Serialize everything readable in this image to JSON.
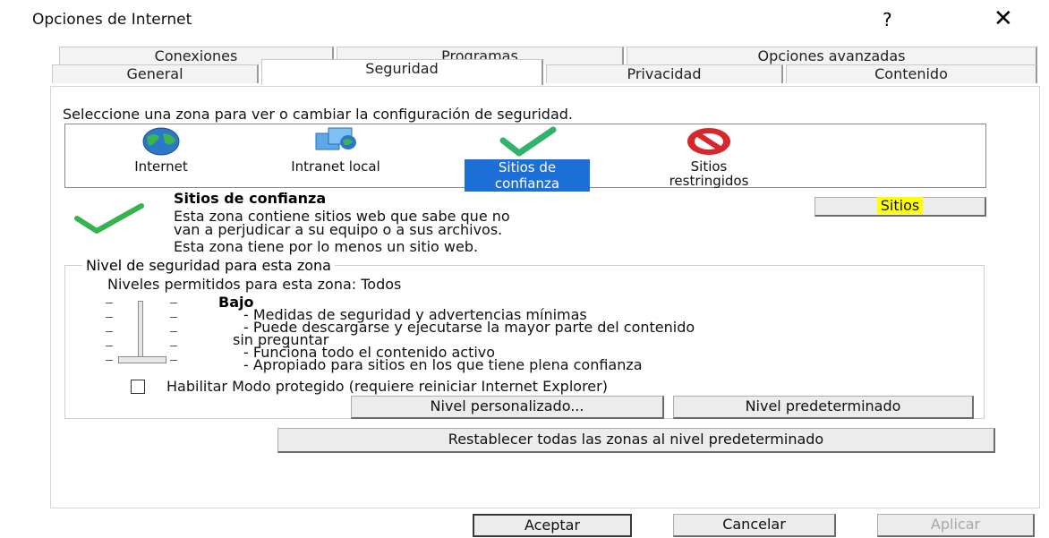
{
  "window": {
    "title": "Opciones de Internet",
    "help_label": "?",
    "close_label": "✕"
  },
  "tabs": {
    "row1": [
      "Conexiones",
      "Programas",
      "Opciones avanzadas"
    ],
    "row2": [
      "General",
      "Seguridad",
      "Privacidad",
      "Contenido"
    ],
    "active": "Seguridad"
  },
  "security": {
    "instruction": "Seleccione una zona para ver o cambiar la configuración de seguridad.",
    "zones": [
      {
        "label": "Internet",
        "icon": "globe-icon"
      },
      {
        "label": "Intranet local",
        "icon": "intranet-icon"
      },
      {
        "label_line1": "Sitios de",
        "label_line2": "confianza",
        "icon": "checkmark-icon",
        "selected": true
      },
      {
        "label_line1": "Sitios",
        "label_line2": "restringidos",
        "icon": "no-entry-icon"
      }
    ],
    "zone_title": "Sitios de confianza",
    "zone_desc_line1": "Esta zona contiene sitios web que sabe que no",
    "zone_desc_line2": "van a perjudicar a su equipo o a sus archivos.",
    "zone_note": "Esta zona tiene por lo menos un sitio web.",
    "sites_button": "Sitios",
    "sites_button_highlight": "#ffff00",
    "level_group_label": "Nivel de seguridad para esta zona",
    "allowed_levels": "Niveles permitidos para esta zona: Todos",
    "level_name": "Bajo",
    "level_desc": [
      "- Medidas de seguridad y advertencias mínimas",
      "- Puede descargarse y ejecutarse la mayor parte del contenido",
      "sin preguntar",
      "- Funciona todo el contenido activo",
      "- Apropiado para sitios en los que tiene plena confianza"
    ],
    "protected_mode_label": "Habilitar Modo protegido (requiere reiniciar Internet Explorer)",
    "protected_mode_checked": false,
    "custom_level_button": "Nivel personalizado...",
    "default_level_button": "Nivel predeterminado",
    "reset_all_button": "Restablecer todas las zonas al nivel predeterminado"
  },
  "footer": {
    "ok": "Aceptar",
    "cancel": "Cancelar",
    "apply": "Aplicar"
  },
  "colors": {
    "selection": "#1d6fd8",
    "check_green": "#2fb36b",
    "no_entry_red": "#d8262d"
  }
}
